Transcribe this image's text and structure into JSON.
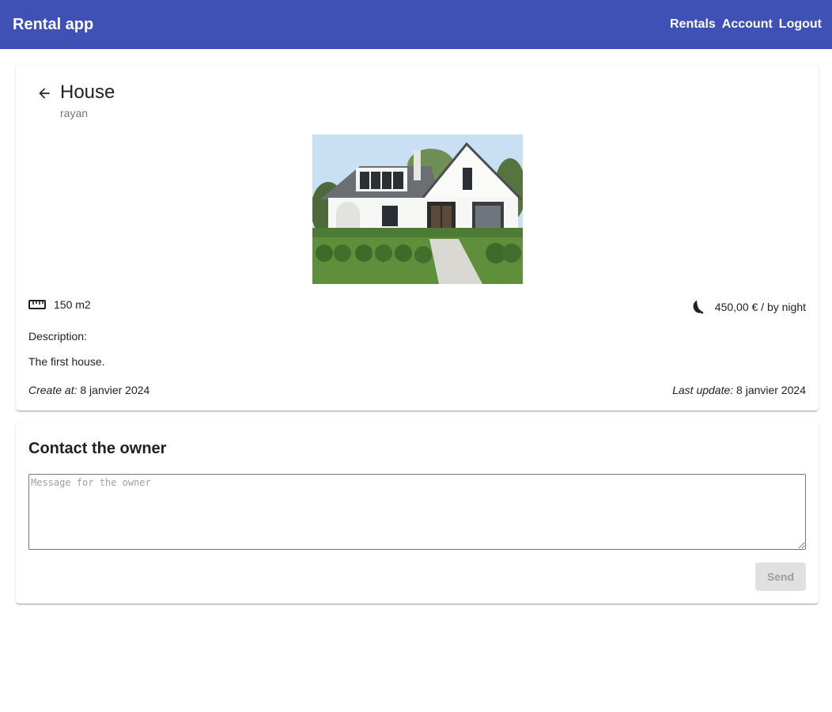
{
  "app": {
    "title": "Rental app",
    "nav": [
      "Rentals",
      "Account",
      "Logout"
    ]
  },
  "rental": {
    "title": "House",
    "owner": "rayan",
    "surface": "150 m2",
    "price": "450,00 € / by night",
    "description_label": "Description:",
    "description": "The first house.",
    "created_label": "Create at:",
    "created_value": "8 janvier 2024",
    "updated_label": "Last update:",
    "updated_value": "8 janvier 2024",
    "icons": {
      "back": "arrow-back-icon",
      "surface": "ruler-icon",
      "price": "night-icon"
    }
  },
  "contact": {
    "title": "Contact the owner",
    "placeholder": "Message for the owner",
    "send_label": "Send"
  },
  "colors": {
    "primary": "#3f51b5",
    "disabled_bg": "#e0e0e0",
    "disabled_text": "#9e9e9e"
  }
}
